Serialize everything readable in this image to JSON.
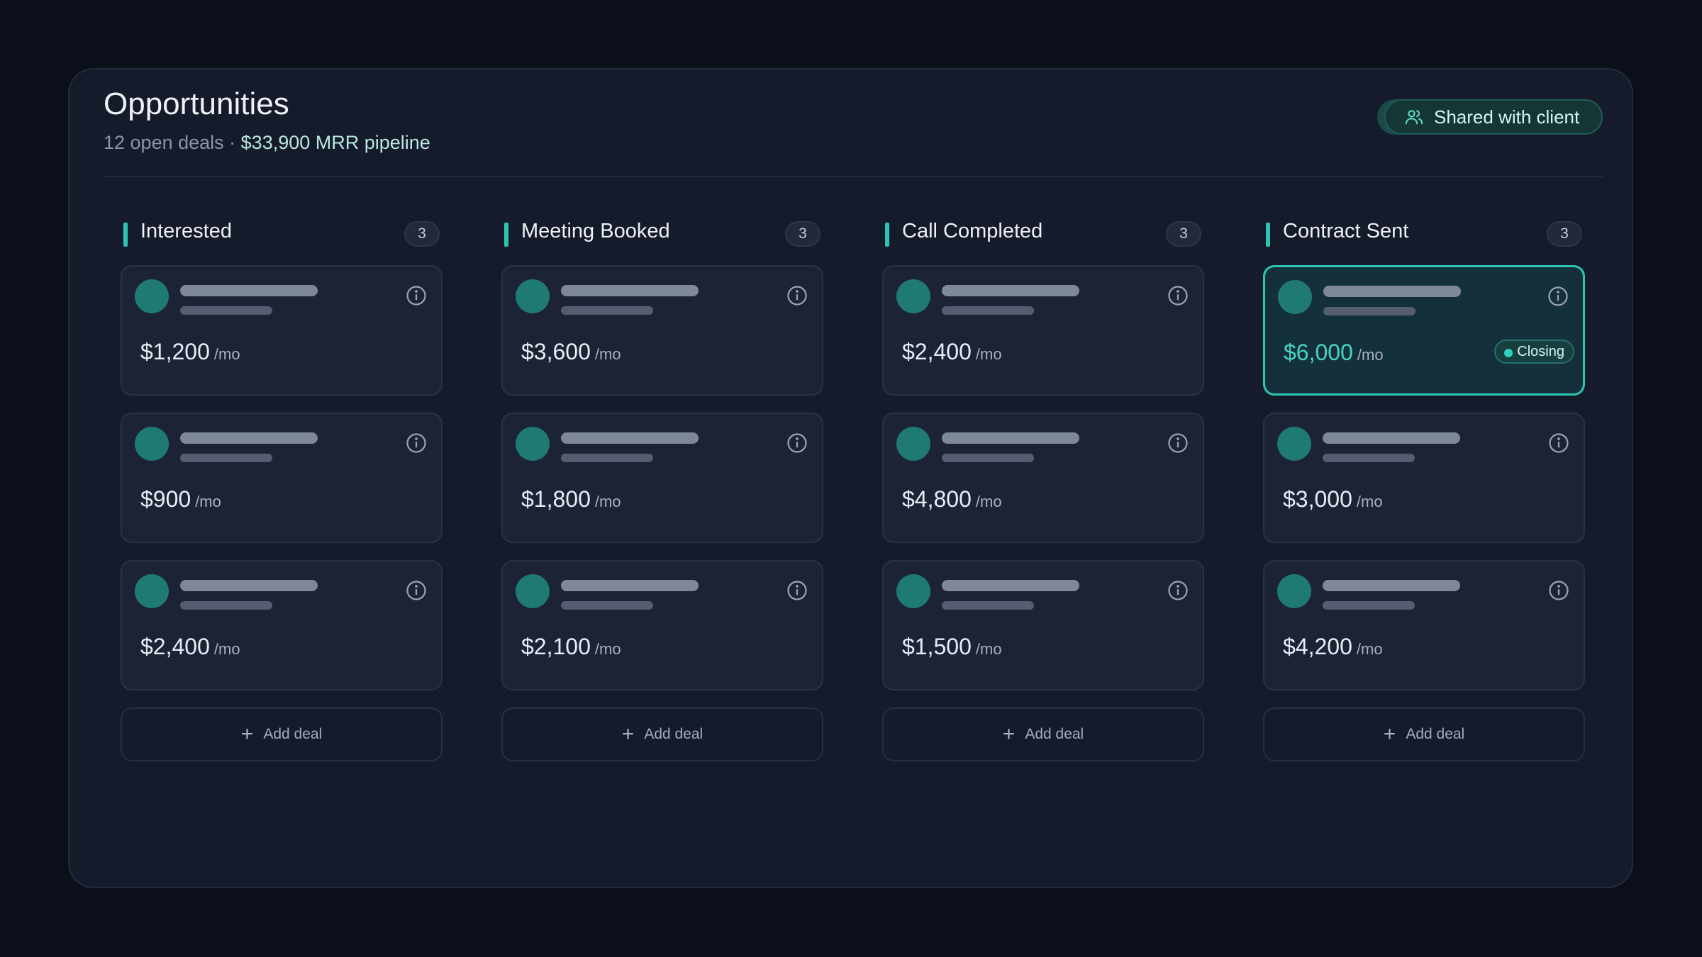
{
  "header": {
    "title": "Opportunities",
    "open_deals": "12 open deals",
    "separator": " · ",
    "pipeline": "$33,900 MRR pipeline",
    "share_label": "Shared with client"
  },
  "columns": [
    {
      "title": "Interested",
      "count": "3",
      "add_label": "Add deal",
      "cards": [
        {
          "amount": "$1,200",
          "unit": "/mo"
        },
        {
          "amount": "$900",
          "unit": "/mo"
        },
        {
          "amount": "$2,400",
          "unit": "/mo"
        }
      ]
    },
    {
      "title": "Meeting Booked",
      "count": "3",
      "add_label": "Add deal",
      "cards": [
        {
          "amount": "$3,600",
          "unit": "/mo"
        },
        {
          "amount": "$1,800",
          "unit": "/mo"
        },
        {
          "amount": "$2,100",
          "unit": "/mo"
        }
      ]
    },
    {
      "title": "Call Completed",
      "count": "3",
      "add_label": "Add deal",
      "cards": [
        {
          "amount": "$2,400",
          "unit": "/mo"
        },
        {
          "amount": "$4,800",
          "unit": "/mo"
        },
        {
          "amount": "$1,500",
          "unit": "/mo"
        }
      ]
    },
    {
      "title": "Contract Sent",
      "count": "3",
      "add_label": "Add deal",
      "cards": [
        {
          "amount": "$6,000",
          "unit": "/mo",
          "badge": "Closing"
        },
        {
          "amount": "$3,000",
          "unit": "/mo"
        },
        {
          "amount": "$4,200",
          "unit": "/mo"
        }
      ]
    }
  ],
  "colors": {
    "accent": "#2cc5b3",
    "highlight_amount": "#47d6c2",
    "background": "#0a0f1a",
    "panel": "#151b2a",
    "card": "#1c2334"
  },
  "icons": {
    "share": "users-icon",
    "card_info": "info-icon",
    "add": "plus-icon",
    "badge": "dot-icon"
  }
}
